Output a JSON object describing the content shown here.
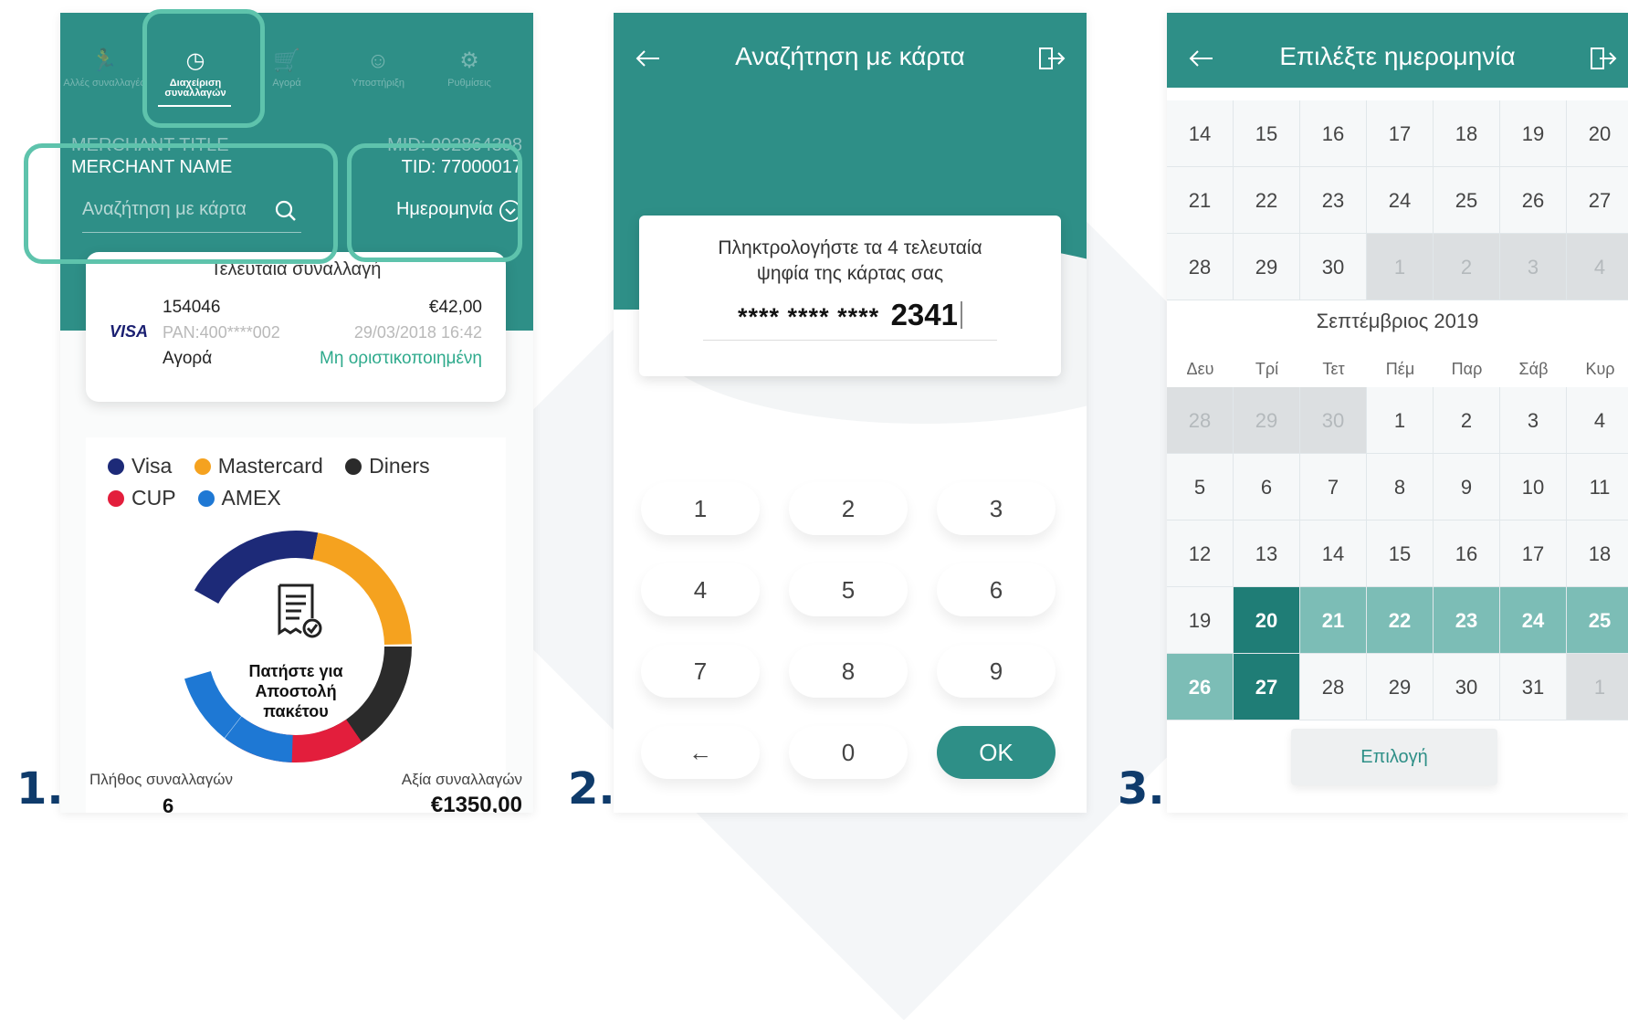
{
  "step_labels": [
    "1.",
    "2.",
    "3."
  ],
  "colors": {
    "teal": "#2e8f87",
    "highlight": "#5ec3ac",
    "visa": "#1d2a78",
    "mastercard": "#f5a21f",
    "diners": "#2b2b2b",
    "cup": "#e31e3c",
    "amex": "#1e78d4"
  },
  "screen1": {
    "nav": [
      {
        "label": "Αλλές συναλλαγές",
        "icon": "runner-icon"
      },
      {
        "label": "Διαχείριση συναλλαγών",
        "icon": "clock-icon"
      },
      {
        "label": "Αγορά",
        "icon": "purchase-icon"
      },
      {
        "label": "Υποστήριξη",
        "icon": "support-icon"
      },
      {
        "label": "Ρυθμίσεις",
        "icon": "settings-icon"
      }
    ],
    "merchant_title": "MERCHANT TITLE",
    "merchant_name": "MERCHANT NAME",
    "mid": "MID: 002864398",
    "tid": "TID: 77000017",
    "search_label": "Αναζήτηση με κάρτα",
    "date_label": "Ημερομηνία",
    "last_tx": {
      "heading": "Τελευταία συναλλαγή",
      "id": "154046",
      "amount": "€42,00",
      "brand": "VISA",
      "pan": "PAN:400****002",
      "datetime": "29/03/2018 16:42",
      "type": "Αγορά",
      "status": "Μη οριστικοποιημένη"
    },
    "legend": [
      "Visa",
      "Mastercard",
      "Diners",
      "CUP",
      "AMEX"
    ],
    "center_text": [
      "Πατήστε για",
      "Αποστολή",
      "πακέτου"
    ],
    "count_label": "Πλήθος συναλλαγών",
    "count_value": "6",
    "value_label": "Αξία συναλλαγών",
    "value_value": "€1350,00"
  },
  "screen2": {
    "title": "Αναζήτηση με κάρτα",
    "prompt_line1": "Πληκτρολογήστε τα 4 τελευταία",
    "prompt_line2": "ψηφία της κάρτας σας",
    "mask": "**** **** ****",
    "digits": "2341",
    "keys": [
      "1",
      "2",
      "3",
      "4",
      "5",
      "6",
      "7",
      "8",
      "9",
      "←",
      "0",
      "OK"
    ]
  },
  "screen3": {
    "title": "Επιλέξτε ημερομηνία",
    "prev_rows": [
      [
        "14",
        "15",
        "16",
        "17",
        "18",
        "19",
        "20"
      ],
      [
        "21",
        "22",
        "23",
        "24",
        "25",
        "26",
        "27"
      ],
      [
        "28",
        "29",
        "30",
        "1",
        "2",
        "3",
        "4"
      ]
    ],
    "month_title": "Σεπτέμβριος 2019",
    "weekdays": [
      "Δευ",
      "Τρί",
      "Τετ",
      "Πέμ",
      "Παρ",
      "Σάβ",
      "Κυρ"
    ],
    "rows": [
      [
        "28",
        "29",
        "30",
        "1",
        "2",
        "3",
        "4"
      ],
      [
        "5",
        "6",
        "7",
        "8",
        "9",
        "10",
        "11"
      ],
      [
        "12",
        "13",
        "14",
        "15",
        "16",
        "17",
        "18"
      ],
      [
        "19",
        "20",
        "21",
        "22",
        "23",
        "24",
        "25"
      ],
      [
        "26",
        "27",
        "28",
        "29",
        "30",
        "31",
        "1"
      ]
    ],
    "select_label": "Επιλογή"
  }
}
